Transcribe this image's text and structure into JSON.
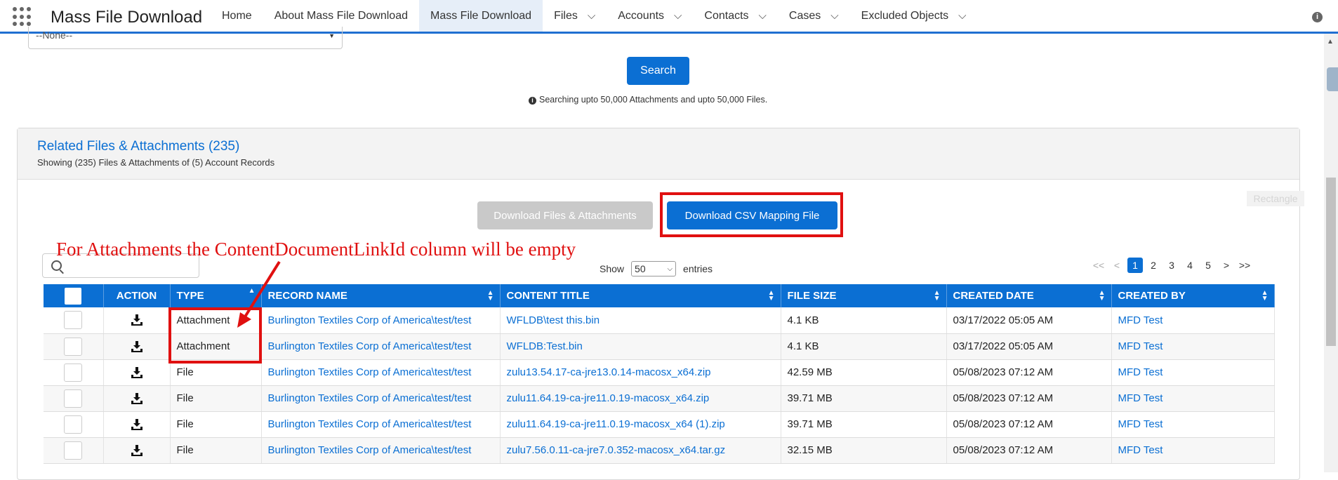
{
  "app": {
    "title": "Mass File Download"
  },
  "nav": {
    "items": [
      {
        "label": "Home",
        "chevron": false,
        "active": false
      },
      {
        "label": "About Mass File Download",
        "chevron": false,
        "active": false
      },
      {
        "label": "Mass File Download",
        "chevron": false,
        "active": true
      },
      {
        "label": "Files",
        "chevron": true,
        "active": false
      },
      {
        "label": "Accounts",
        "chevron": true,
        "active": false
      },
      {
        "label": "Contacts",
        "chevron": true,
        "active": false
      },
      {
        "label": "Cases",
        "chevron": true,
        "active": false
      },
      {
        "label": "Excluded Objects",
        "chevron": true,
        "active": false
      }
    ]
  },
  "filter": {
    "select_value": "--None--"
  },
  "search": {
    "button_label": "Search",
    "note": "Searching upto 50,000 Attachments and upto 50,000 Files."
  },
  "card": {
    "title": "Related Files & Attachments (235)",
    "subtitle": "Showing (235) Files & Attachments of (5) Account Records",
    "download_files_label": "Download Files & Attachments",
    "download_csv_label": "Download CSV Mapping File",
    "rect_tag": "Rectangle"
  },
  "annotation": "For Attachments the ContentDocumentLinkId column will be empty",
  "table_controls": {
    "show_label": "Show",
    "page_size": "50",
    "entries_label": "entries",
    "pager": [
      "<<",
      "<",
      "1",
      "2",
      "3",
      "4",
      "5",
      ">",
      ">>"
    ],
    "current_page": "1"
  },
  "table": {
    "columns": [
      "ACTION",
      "TYPE",
      "RECORD NAME",
      "CONTENT TITLE",
      "FILE SIZE",
      "CREATED DATE",
      "CREATED BY"
    ],
    "rows": [
      {
        "type": "Attachment",
        "record": "Burlington Textiles Corp of America\\test/test",
        "title": "WFLDB\\test this.bin",
        "size": "4.1 KB",
        "date": "03/17/2022 05:05 AM",
        "by": "MFD Test"
      },
      {
        "type": "Attachment",
        "record": "Burlington Textiles Corp of America\\test/test",
        "title": "WFLDB:Test.bin",
        "size": "4.1 KB",
        "date": "03/17/2022 05:05 AM",
        "by": "MFD Test"
      },
      {
        "type": "File",
        "record": "Burlington Textiles Corp of America\\test/test",
        "title": "zulu13.54.17-ca-jre13.0.14-macosx_x64.zip",
        "size": "42.59 MB",
        "date": "05/08/2023 07:12 AM",
        "by": "MFD Test"
      },
      {
        "type": "File",
        "record": "Burlington Textiles Corp of America\\test/test",
        "title": "zulu11.64.19-ca-jre11.0.19-macosx_x64.zip",
        "size": "39.71 MB",
        "date": "05/08/2023 07:12 AM",
        "by": "MFD Test"
      },
      {
        "type": "File",
        "record": "Burlington Textiles Corp of America\\test/test",
        "title": "zulu11.64.19-ca-jre11.0.19-macosx_x64 (1).zip",
        "size": "39.71 MB",
        "date": "05/08/2023 07:12 AM",
        "by": "MFD Test"
      },
      {
        "type": "File",
        "record": "Burlington Textiles Corp of America\\test/test",
        "title": "zulu7.56.0.11-ca-jre7.0.352-macosx_x64.tar.gz",
        "size": "32.15 MB",
        "date": "05/08/2023 07:12 AM",
        "by": "MFD Test"
      }
    ]
  },
  "colors": {
    "brand": "#0b6fd3",
    "annotation": "#e01010"
  },
  "icons": [
    "app-launcher-icon",
    "info-icon",
    "search-icon",
    "download-icon",
    "sort-icon",
    "chevron-down-icon"
  ]
}
